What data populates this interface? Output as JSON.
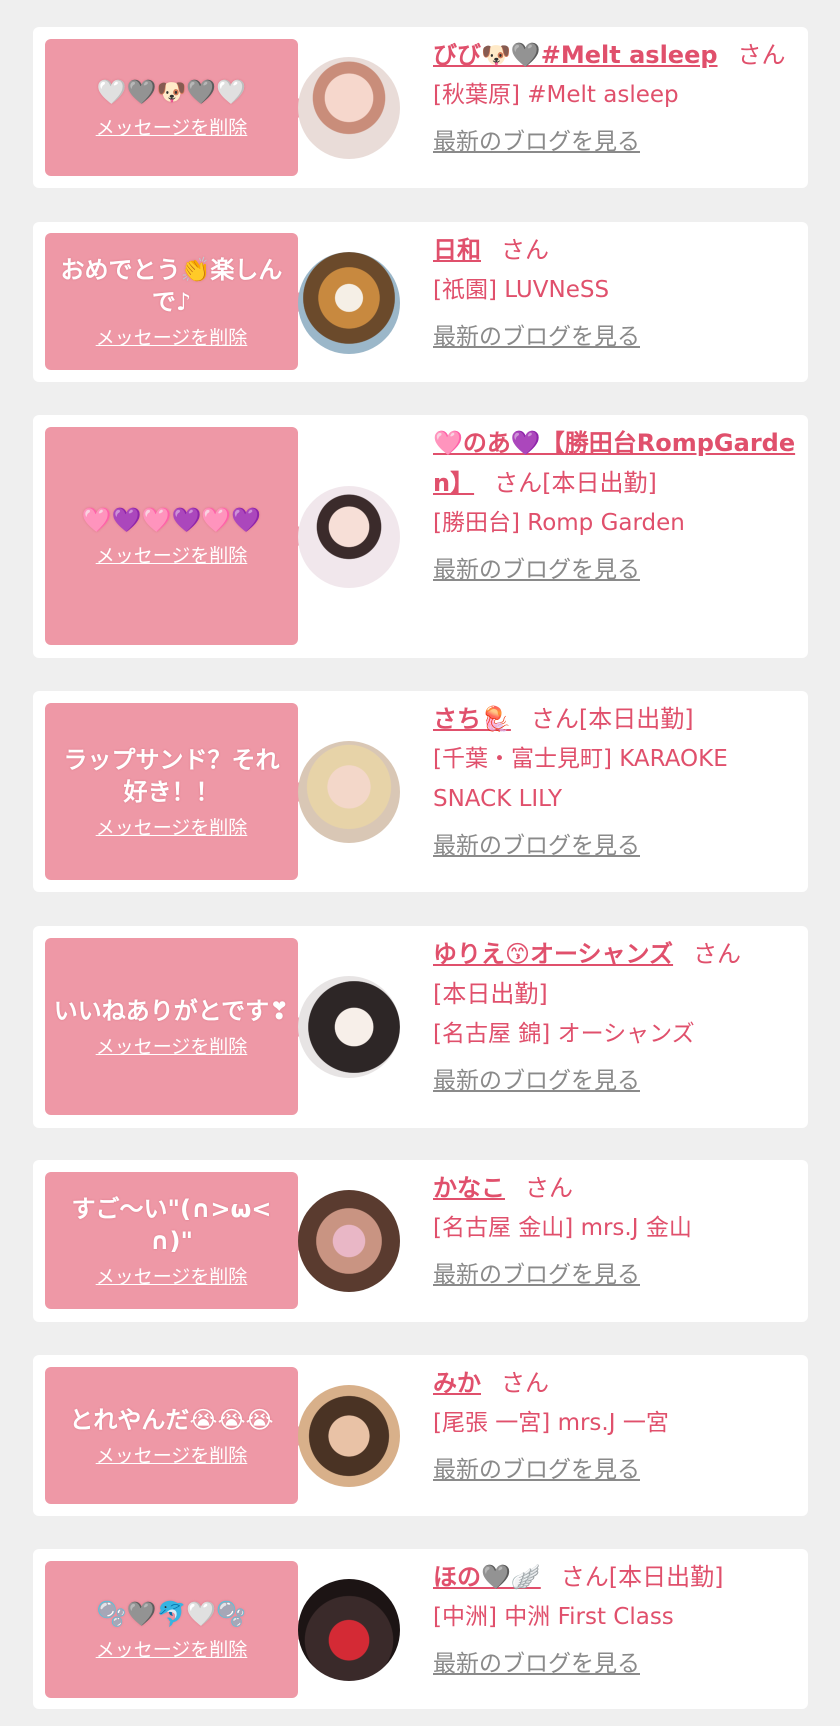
{
  "colors": {
    "background": "#efefef",
    "card": "#ffffff",
    "bubble": "#ee98a6",
    "accent": "#e0506c",
    "link_gray": "#8a8a8a"
  },
  "delete_label": "メッセージを削除",
  "blog_label": "最新のブログを見る",
  "san_label": "さん",
  "entries": [
    {
      "message": "🤍🩶🐶🩶🤍",
      "name": "びび🐶🩶#Melt asleep",
      "status": "",
      "shop": "[秋葉原] #Melt asleep",
      "avatar_icon": "avatar-photo"
    },
    {
      "message": "おめでとう👏楽しんで♪",
      "name": "日和",
      "status": "",
      "shop": "[祇園] LUVNeSS",
      "avatar_icon": "avatar-photo"
    },
    {
      "message": "🩷💜🩷💜🩷💜",
      "name": "🩷のあ💜【勝田台RompGarden】",
      "status": "[本日出勤]",
      "shop": "[勝田台] Romp Garden",
      "avatar_icon": "avatar-photo"
    },
    {
      "message": "ラップサンド？それ好き！！",
      "name": "さち🪼",
      "status": "[本日出勤]",
      "shop": "[千葉・富士見町] KARAOKE SNACK LILY",
      "avatar_icon": "avatar-photo"
    },
    {
      "message": "いいねありがとです❣",
      "name": "ゆりえ😙オーシャンズ",
      "status": "[本日出勤]",
      "shop": "[名古屋 錦] オーシャンズ",
      "avatar_icon": "avatar-photo"
    },
    {
      "message": "すご〜い\"(∩>ω<∩)\"",
      "name": "かなこ",
      "status": "",
      "shop": "[名古屋 金山] mrs.J 金山",
      "avatar_icon": "avatar-photo"
    },
    {
      "message": "とれやんだ😭😭😭",
      "name": "みか",
      "status": "",
      "shop": "[尾張 一宮] mrs.J 一宮",
      "avatar_icon": "avatar-photo"
    },
    {
      "message": "🫧🩶🐬🤍🫧",
      "name": "ほの🩶🪽",
      "status": "[本日出勤]",
      "shop": "[中洲] 中洲 First Class",
      "avatar_icon": "avatar-photo"
    }
  ]
}
